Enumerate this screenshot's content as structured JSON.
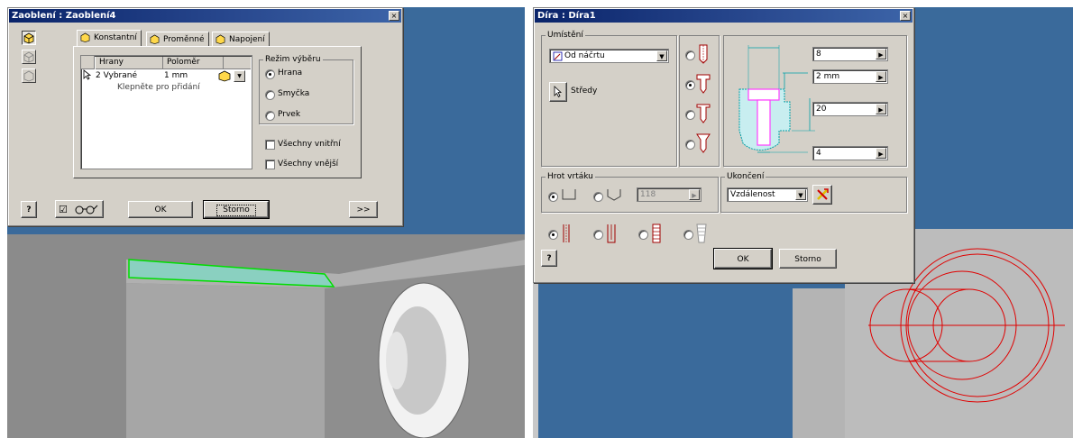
{
  "fillet_dialog": {
    "title": "Zaoblení : Zaoblení4",
    "close_glyph": "×",
    "tabs": [
      {
        "label": "Konstantní",
        "icon": "constant-fillet-icon"
      },
      {
        "label": "Proměnné",
        "icon": "variable-fillet-icon"
      },
      {
        "label": "Napojení",
        "icon": "setback-icon"
      }
    ],
    "table": {
      "headers": [
        "Hrany",
        "Poloměr"
      ],
      "row": {
        "edges": "2 Vybrané",
        "radius": "1 mm"
      },
      "add_hint": "Klepněte pro přidání"
    },
    "selection_mode": {
      "legend": "Režim výběru",
      "options": [
        "Hrana",
        "Smyčka",
        "Prvek"
      ],
      "selected": "Hrana"
    },
    "checkboxes": [
      {
        "label": "Všechny vnitřní",
        "checked": false
      },
      {
        "label": "Všechny vnější",
        "checked": false
      }
    ],
    "preview_check": {
      "glyph": "☑",
      "checked": true,
      "icon": "glasses-icon"
    },
    "help_glyph": "?",
    "ok_label": "OK",
    "cancel_label": "Storno",
    "more_label": ">>"
  },
  "hole_dialog": {
    "title": "Díra : Díra1",
    "close_glyph": "×",
    "placement": {
      "legend": "Umístění",
      "dropdown_value": "Od náčrtu",
      "centers_label": "Středy"
    },
    "hole_types": [
      "simple-hole",
      "counterbore",
      "spotface",
      "countersink"
    ],
    "hole_type_selected": 1,
    "dimensions": [
      "8",
      "2 mm",
      "20",
      "4"
    ],
    "drill_point": {
      "legend": "Hrot vrtáku",
      "options": [
        "flat",
        "angle"
      ],
      "selected": 0,
      "angle_value": "118"
    },
    "termination": {
      "legend": "Ukončení",
      "value": "Vzdálenost"
    },
    "thread_options_selected": 0,
    "help_glyph": "?",
    "ok_label": "OK",
    "cancel_label": "Storno"
  },
  "colors": {
    "viewport_bg": "#3a6a9b",
    "dialog_bg": "#d4d0c8",
    "title_bar": "#0a246a",
    "highlight_edge": "#00dd00",
    "sketch_red": "#e00000",
    "diagram_cyan": "#60d0d8",
    "diagram_magenta": "#ff40ff"
  }
}
